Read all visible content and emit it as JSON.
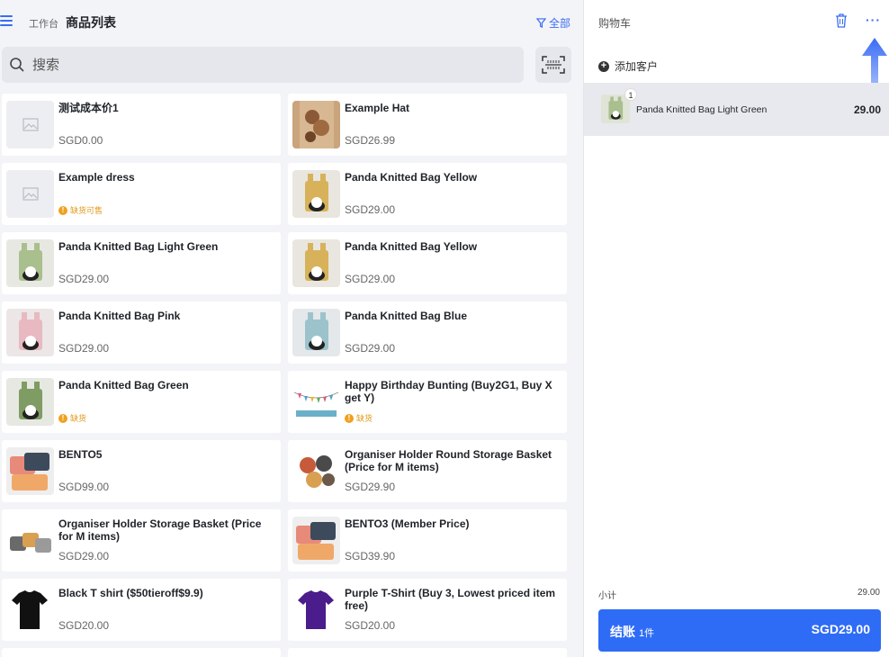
{
  "header": {
    "breadcrumb": "工作台",
    "title": "商品列表",
    "filter_label": "全部"
  },
  "search": {
    "placeholder": "搜索"
  },
  "products": [
    {
      "name": "测试成本价1",
      "price": "SGD0.00"
    },
    {
      "name": "Example Hat",
      "price": "SGD26.99"
    },
    {
      "name": "Example dress",
      "stock": "缺货可售"
    },
    {
      "name": "Panda Knitted Bag Yellow",
      "price": "SGD29.00"
    },
    {
      "name": "Panda Knitted Bag Light Green",
      "price": "SGD29.00"
    },
    {
      "name": "Panda Knitted Bag Yellow",
      "price": "SGD29.00"
    },
    {
      "name": "Panda Knitted Bag Pink",
      "price": "SGD29.00"
    },
    {
      "name": "Panda Knitted Bag Blue",
      "price": "SGD29.00"
    },
    {
      "name": "Panda Knitted Bag Green",
      "stock": "缺货"
    },
    {
      "name": "Happy Birthday Bunting (Buy2G1, Buy X get Y)",
      "stock": "缺货"
    },
    {
      "name": "BENTO5",
      "price": "SGD99.00"
    },
    {
      "name": "Organiser Holder Round Storage Basket (Price for M items)",
      "price": "SGD29.90"
    },
    {
      "name": "Organiser Holder Storage Basket (Price for M items)",
      "price": "SGD29.00"
    },
    {
      "name": "BENTO3 (Member Price)",
      "price": "SGD39.90"
    },
    {
      "name": "Black T shirt ($50tieroff$9.9)",
      "price": "SGD20.00"
    },
    {
      "name": "Purple T-Shirt (Buy 3, Lowest priced item free)",
      "price": "SGD20.00"
    }
  ],
  "cart": {
    "title": "购物车",
    "add_customer": "添加客户",
    "items": [
      {
        "qty": "1",
        "name": "Panda Knitted Bag Light Green",
        "price": "29.00"
      }
    ],
    "subtotal_label": "小计",
    "subtotal_value": "29.00",
    "checkout_label": "结账",
    "checkout_count": "1件",
    "checkout_amount": "SGD29.00"
  },
  "colors": {
    "accent": "#2e6cf6",
    "warning": "#f0a020"
  }
}
